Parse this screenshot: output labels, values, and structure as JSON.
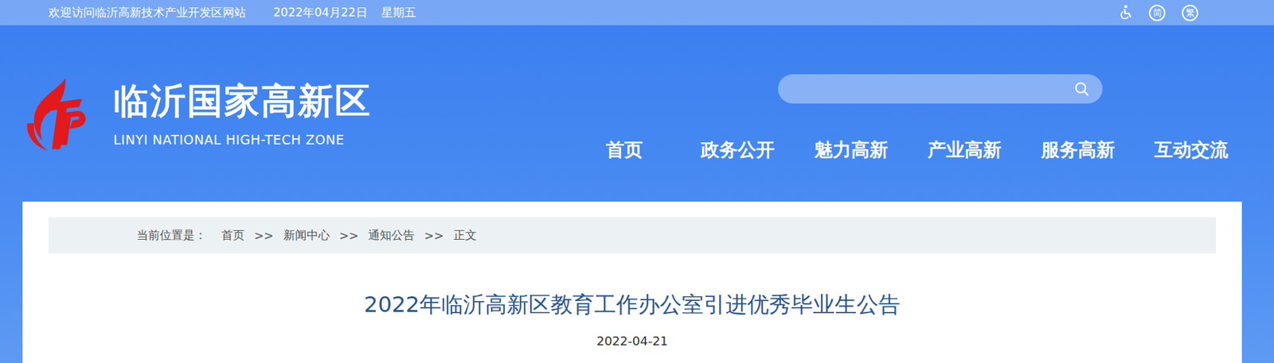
{
  "top_bar": {
    "welcome": "欢迎访问临沂高新技术产业开发区网站",
    "date": "2022年04月22日",
    "weekday": "星期五",
    "simplified": "简",
    "traditional": "繁"
  },
  "header": {
    "site_name": "临沂国家高新区",
    "site_name_en": "LINYI NATIONAL HIGH-TECH ZONE"
  },
  "nav": [
    "首页",
    "政务公开",
    "魅力高新",
    "产业高新",
    "服务高新",
    "互动交流"
  ],
  "breadcrumb": {
    "label": "当前位置是：",
    "separator": ">>",
    "items": [
      "首页",
      "新闻中心",
      "通知公告",
      "正文"
    ]
  },
  "article": {
    "title": "2022年临沂高新区教育工作办公室引进优秀毕业生公告",
    "date": "2022-04-21"
  }
}
